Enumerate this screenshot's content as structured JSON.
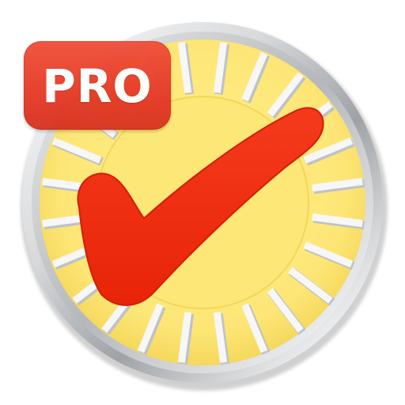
{
  "badge": {
    "label": "PRO"
  },
  "colors": {
    "dial_face": "#fde876",
    "dial_tick": "#f7f7f7",
    "ring_chrome": "#c4c6c8",
    "checkmark": "#ee2a0e",
    "badge_red": "#e8402c",
    "background": "#ffffff"
  },
  "icons": {
    "main": "checkmark-dial-icon",
    "badge": "pro-badge"
  }
}
